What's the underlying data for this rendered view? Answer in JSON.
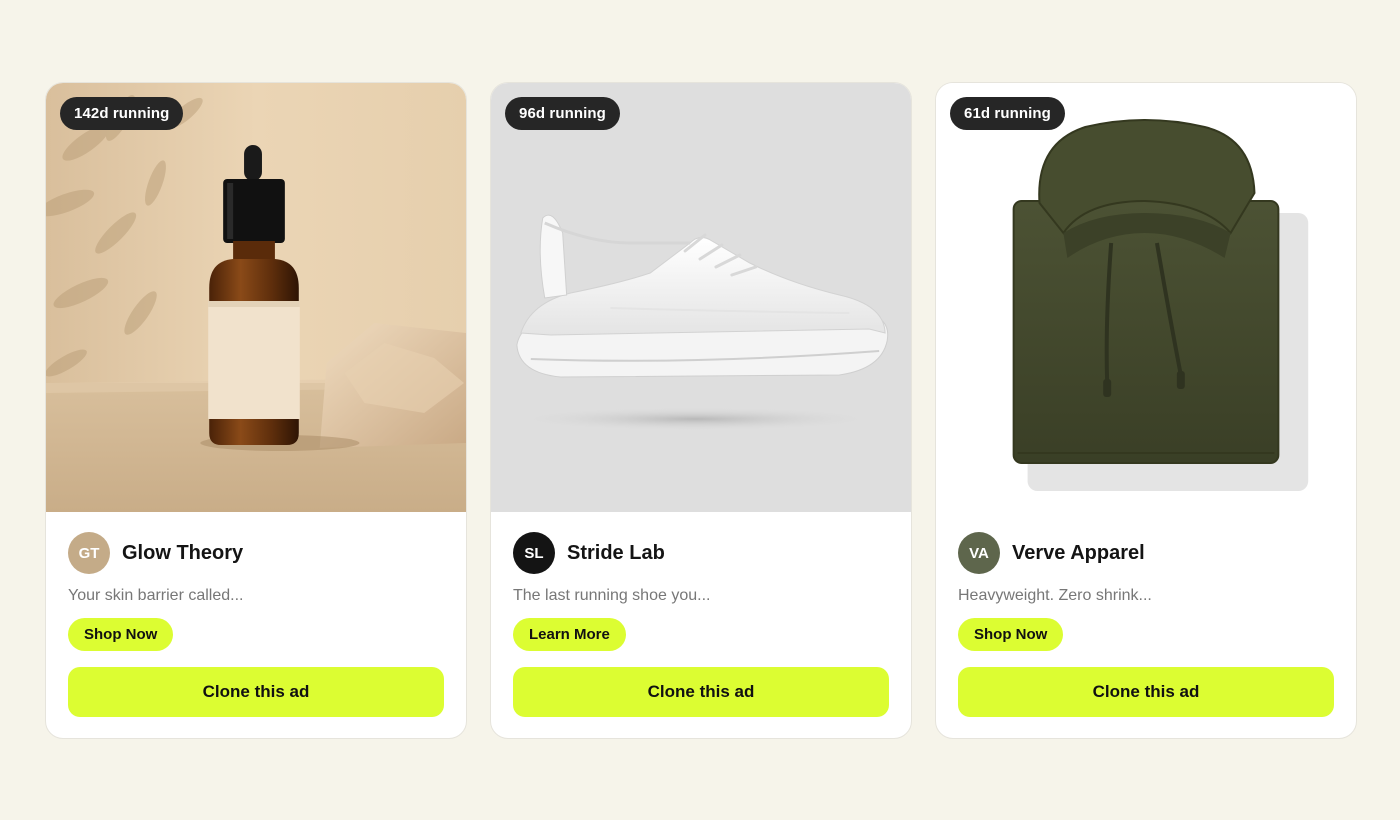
{
  "cards": [
    {
      "badge": "142d running",
      "initials": "GT",
      "avatar_color": "#c4ab88",
      "brand": "Glow Theory",
      "description": "Your skin barrier called...",
      "cta": "Shop Now",
      "clone_label": "Clone this ad",
      "image": "serum-dropper-bottle"
    },
    {
      "badge": "96d running",
      "initials": "SL",
      "avatar_color": "#141414",
      "brand": "Stride Lab",
      "description": "The last running shoe you...",
      "cta": "Learn More",
      "clone_label": "Clone this ad",
      "image": "white-running-shoe"
    },
    {
      "badge": "61d running",
      "initials": "VA",
      "avatar_color": "#5e664c",
      "brand": "Verve Apparel",
      "description": "Heavyweight. Zero shrink...",
      "cta": "Shop Now",
      "clone_label": "Clone this ad",
      "image": "olive-folded-hoodie"
    }
  ],
  "colors": {
    "page_background": "#f6f4ea",
    "accent": "#dcfd32",
    "badge_background": "#262626"
  }
}
